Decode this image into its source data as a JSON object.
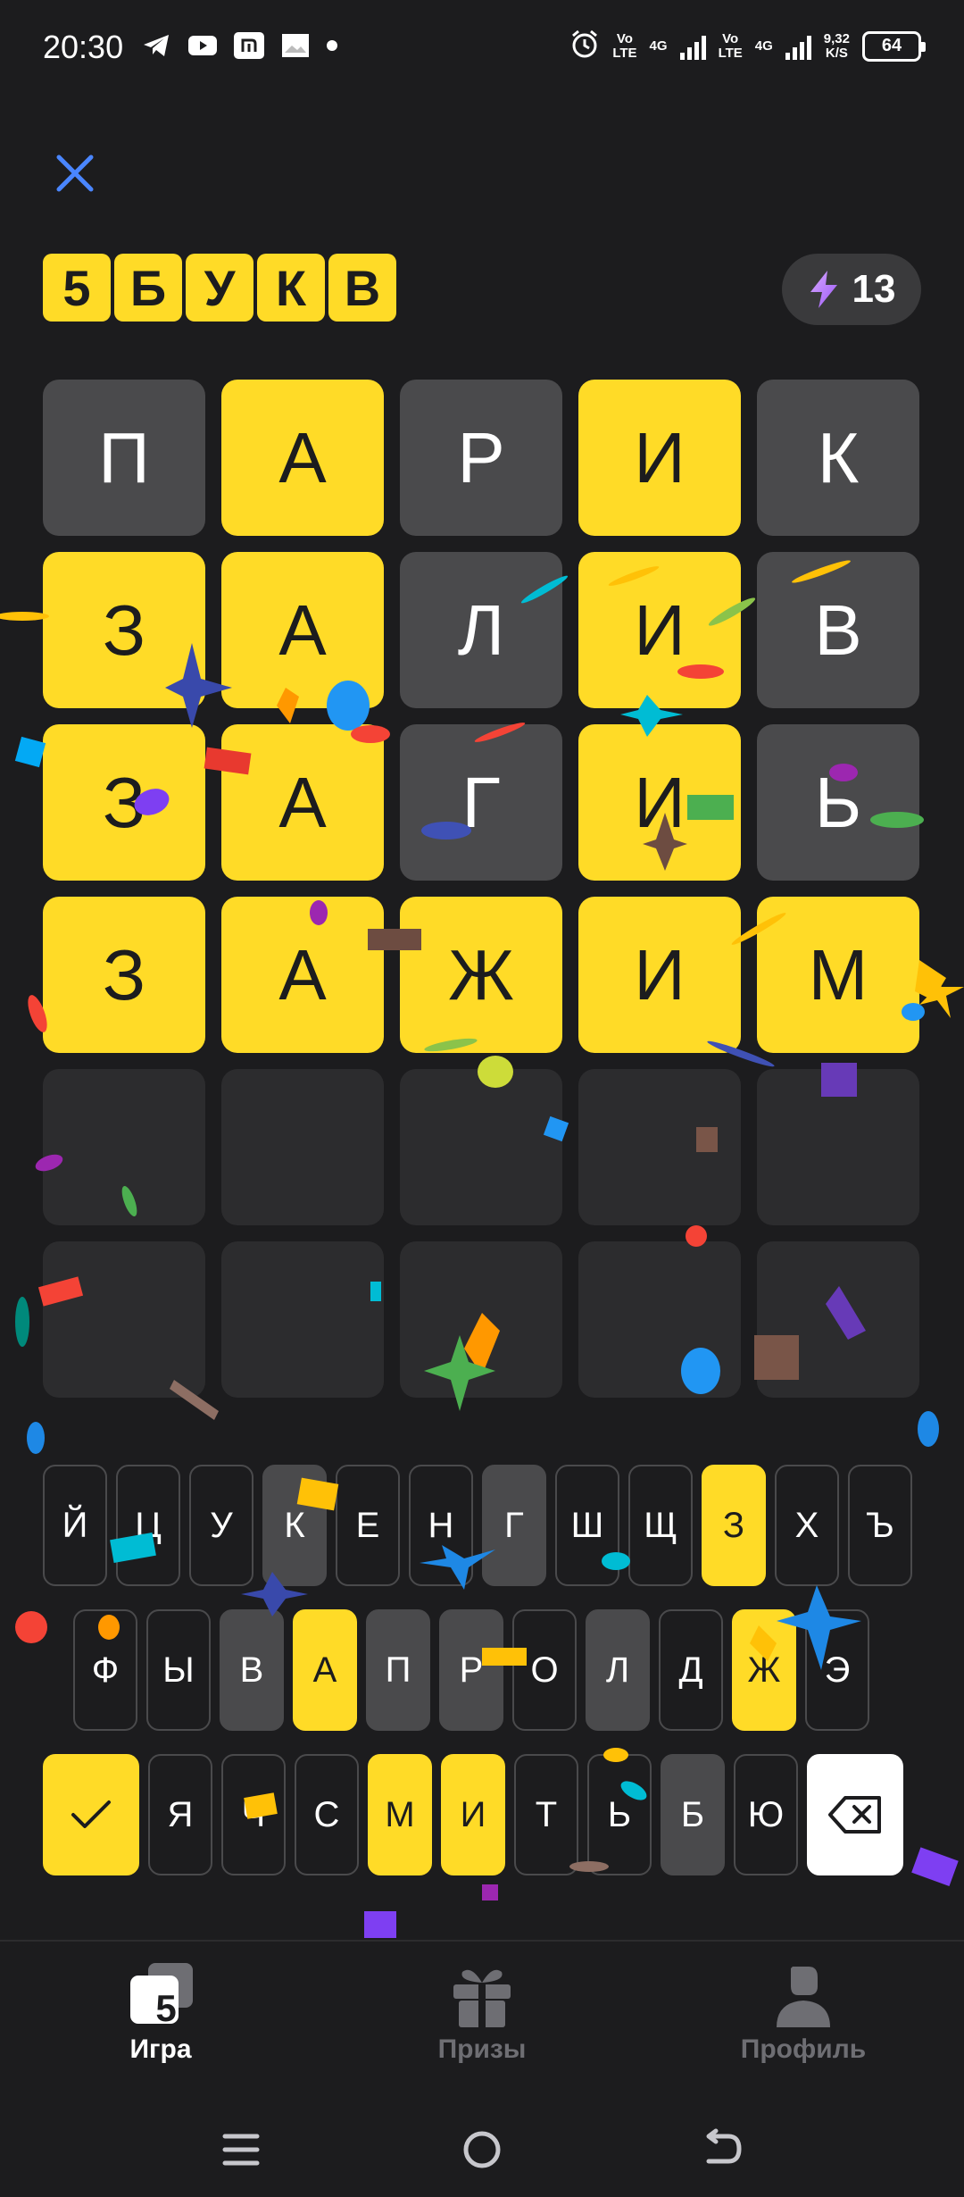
{
  "status_bar": {
    "time": "20:30",
    "net1_top": "Vo",
    "net1_bottom": "LTE",
    "net2": "4G",
    "net3_top": "Vo",
    "net3_bottom": "LTE",
    "net4": "4G",
    "speed_top": "9,32",
    "speed_bottom": "K/S",
    "battery": "64"
  },
  "header": {
    "logo_letters": [
      "5",
      "Б",
      "У",
      "К",
      "В"
    ],
    "energy_count": "13"
  },
  "board": {
    "rows": [
      [
        {
          "l": "П",
          "s": "gray"
        },
        {
          "l": "А",
          "s": "yellow"
        },
        {
          "l": "Р",
          "s": "gray"
        },
        {
          "l": "И",
          "s": "yellow"
        },
        {
          "l": "К",
          "s": "gray"
        }
      ],
      [
        {
          "l": "З",
          "s": "yellow"
        },
        {
          "l": "А",
          "s": "yellow"
        },
        {
          "l": "Л",
          "s": "gray"
        },
        {
          "l": "И",
          "s": "yellow"
        },
        {
          "l": "В",
          "s": "gray"
        }
      ],
      [
        {
          "l": "З",
          "s": "yellow"
        },
        {
          "l": "А",
          "s": "yellow"
        },
        {
          "l": "Г",
          "s": "gray"
        },
        {
          "l": "И",
          "s": "yellow"
        },
        {
          "l": "Ь",
          "s": "gray"
        }
      ],
      [
        {
          "l": "З",
          "s": "yellow"
        },
        {
          "l": "А",
          "s": "yellow"
        },
        {
          "l": "Ж",
          "s": "yellow"
        },
        {
          "l": "И",
          "s": "yellow"
        },
        {
          "l": "М",
          "s": "yellow"
        }
      ],
      [
        {
          "l": "",
          "s": "empty"
        },
        {
          "l": "",
          "s": "empty"
        },
        {
          "l": "",
          "s": "empty"
        },
        {
          "l": "",
          "s": "empty"
        },
        {
          "l": "",
          "s": "empty"
        }
      ],
      [
        {
          "l": "",
          "s": "empty"
        },
        {
          "l": "",
          "s": "empty"
        },
        {
          "l": "",
          "s": "empty"
        },
        {
          "l": "",
          "s": "empty"
        },
        {
          "l": "",
          "s": "empty"
        }
      ]
    ]
  },
  "keyboard": {
    "row1": [
      {
        "k": "Й",
        "s": ""
      },
      {
        "k": "Ц",
        "s": ""
      },
      {
        "k": "У",
        "s": ""
      },
      {
        "k": "К",
        "s": "gray"
      },
      {
        "k": "Е",
        "s": ""
      },
      {
        "k": "Н",
        "s": ""
      },
      {
        "k": "Г",
        "s": "gray"
      },
      {
        "k": "Ш",
        "s": ""
      },
      {
        "k": "Щ",
        "s": ""
      },
      {
        "k": "З",
        "s": "yellow"
      },
      {
        "k": "Х",
        "s": ""
      },
      {
        "k": "Ъ",
        "s": ""
      }
    ],
    "row2": [
      {
        "k": "Ф",
        "s": ""
      },
      {
        "k": "Ы",
        "s": ""
      },
      {
        "k": "В",
        "s": "gray"
      },
      {
        "k": "А",
        "s": "yellow"
      },
      {
        "k": "П",
        "s": "gray"
      },
      {
        "k": "Р",
        "s": "gray"
      },
      {
        "k": "О",
        "s": ""
      },
      {
        "k": "Л",
        "s": "gray"
      },
      {
        "k": "Д",
        "s": ""
      },
      {
        "k": "Ж",
        "s": "yellow"
      },
      {
        "k": "Э",
        "s": ""
      }
    ],
    "row3": [
      {
        "k": "Я",
        "s": ""
      },
      {
        "k": "Ч",
        "s": ""
      },
      {
        "k": "С",
        "s": ""
      },
      {
        "k": "М",
        "s": "yellow"
      },
      {
        "k": "И",
        "s": "yellow"
      },
      {
        "k": "Т",
        "s": ""
      },
      {
        "k": "Ь",
        "s": ""
      },
      {
        "k": "Б",
        "s": "gray"
      },
      {
        "k": "Ю",
        "s": ""
      }
    ]
  },
  "nav": {
    "game": "Игра",
    "game_badge": "5",
    "prizes": "Призы",
    "profile": "Профиль"
  },
  "colors": {
    "accent": "#ffdb27",
    "absent": "#4a4a4c",
    "empty": "#2c2c2e",
    "background": "#1c1c1e",
    "close": "#4a86ff"
  }
}
